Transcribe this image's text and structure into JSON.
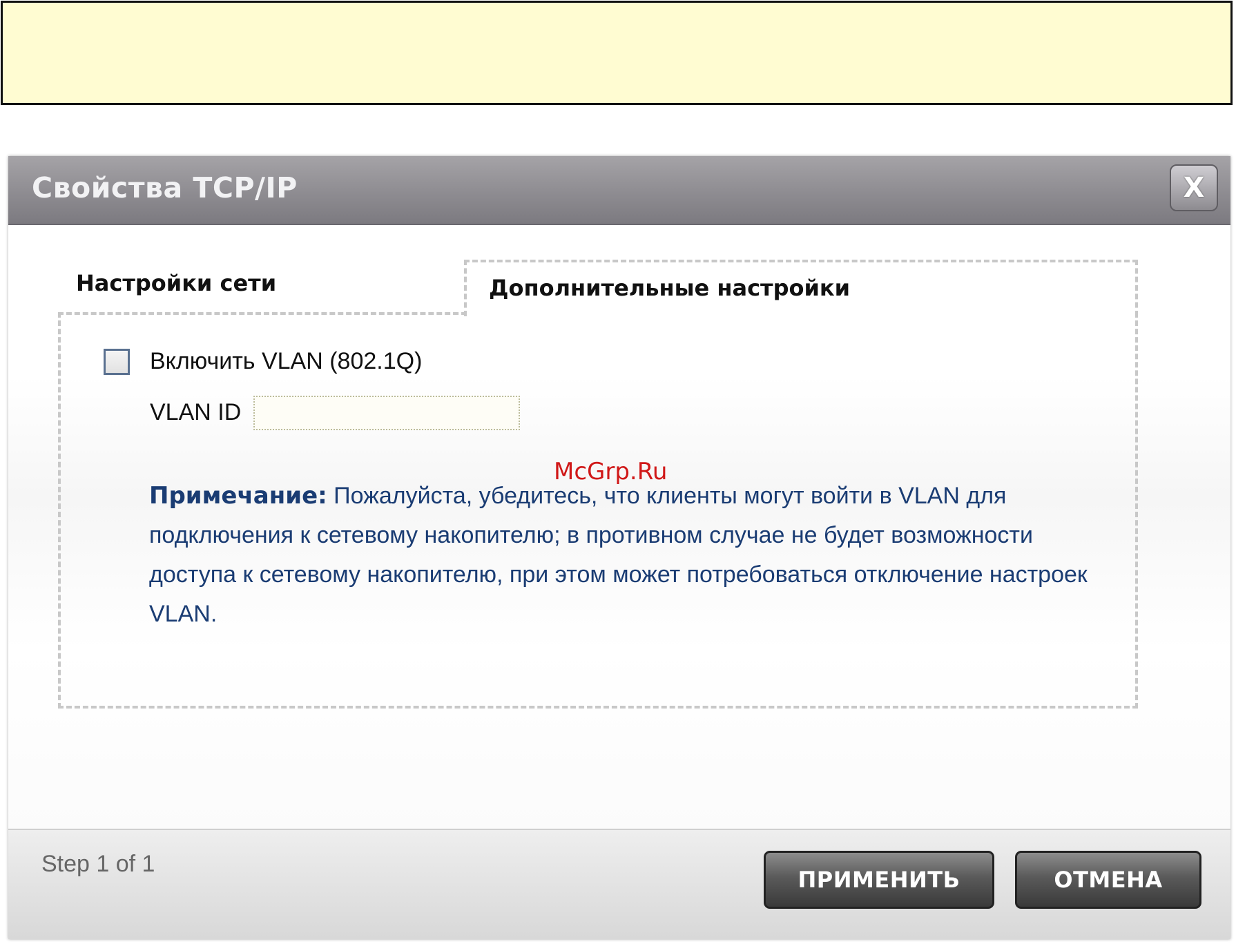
{
  "dialog": {
    "title": "Свойства TCP/IP",
    "close_label": "X"
  },
  "tabs": [
    {
      "label": "Настройки сети",
      "active": false
    },
    {
      "label": "Дополнительные настройки",
      "active": true
    }
  ],
  "vlan": {
    "checkbox_label": "Включить VLAN (802.1Q)",
    "checked": false,
    "id_label": "VLAN ID",
    "id_value": ""
  },
  "note": {
    "prefix": "Примечание:",
    "text": " Пожалуйста, убедитесь, что клиенты могут войти в VLAN для подключения к сетевому накопителю; в противном случае не будет возможности доступа к сетевому накопителю, при этом может потребоваться отключение настроек VLAN."
  },
  "watermark": "McGrp.Ru",
  "footer": {
    "step": "Step 1 of 1",
    "apply_label": "ПРИМЕНИТЬ",
    "cancel_label": "ОТМЕНА"
  },
  "colors": {
    "banner": "#fffcd2",
    "titlebar": "#8e8c91",
    "note_text": "#1a3c73",
    "watermark": "#d01818"
  }
}
